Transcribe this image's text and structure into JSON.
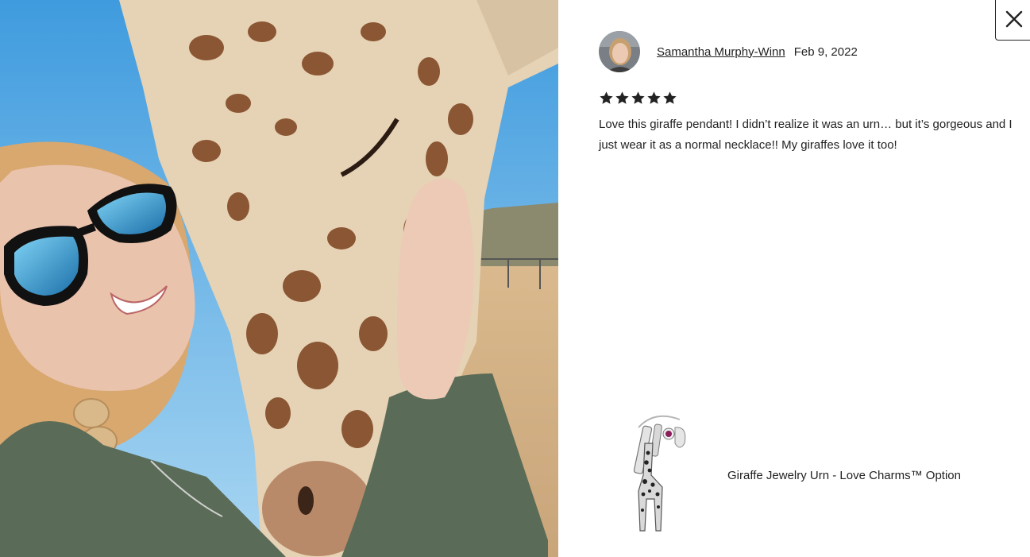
{
  "photo": {
    "icon": "review-photo",
    "alt": ""
  },
  "dialog": {
    "close_icon": "close-icon"
  },
  "review": {
    "reviewer_name": "Samantha Murphy-Winn",
    "date": "Feb 9, 2022",
    "rating": 5,
    "rating_max": 5,
    "text": "Love this giraffe pendant! I didn’t realize it was an urn… but it’s gorgeous and I just wear it as a normal necklace!! My giraffes love it too!"
  },
  "product": {
    "title": "Giraffe Jewelry Urn - Love Charms™ Option"
  },
  "colors": {
    "text": "#222222",
    "background": "#ffffff",
    "star": "#222222"
  }
}
